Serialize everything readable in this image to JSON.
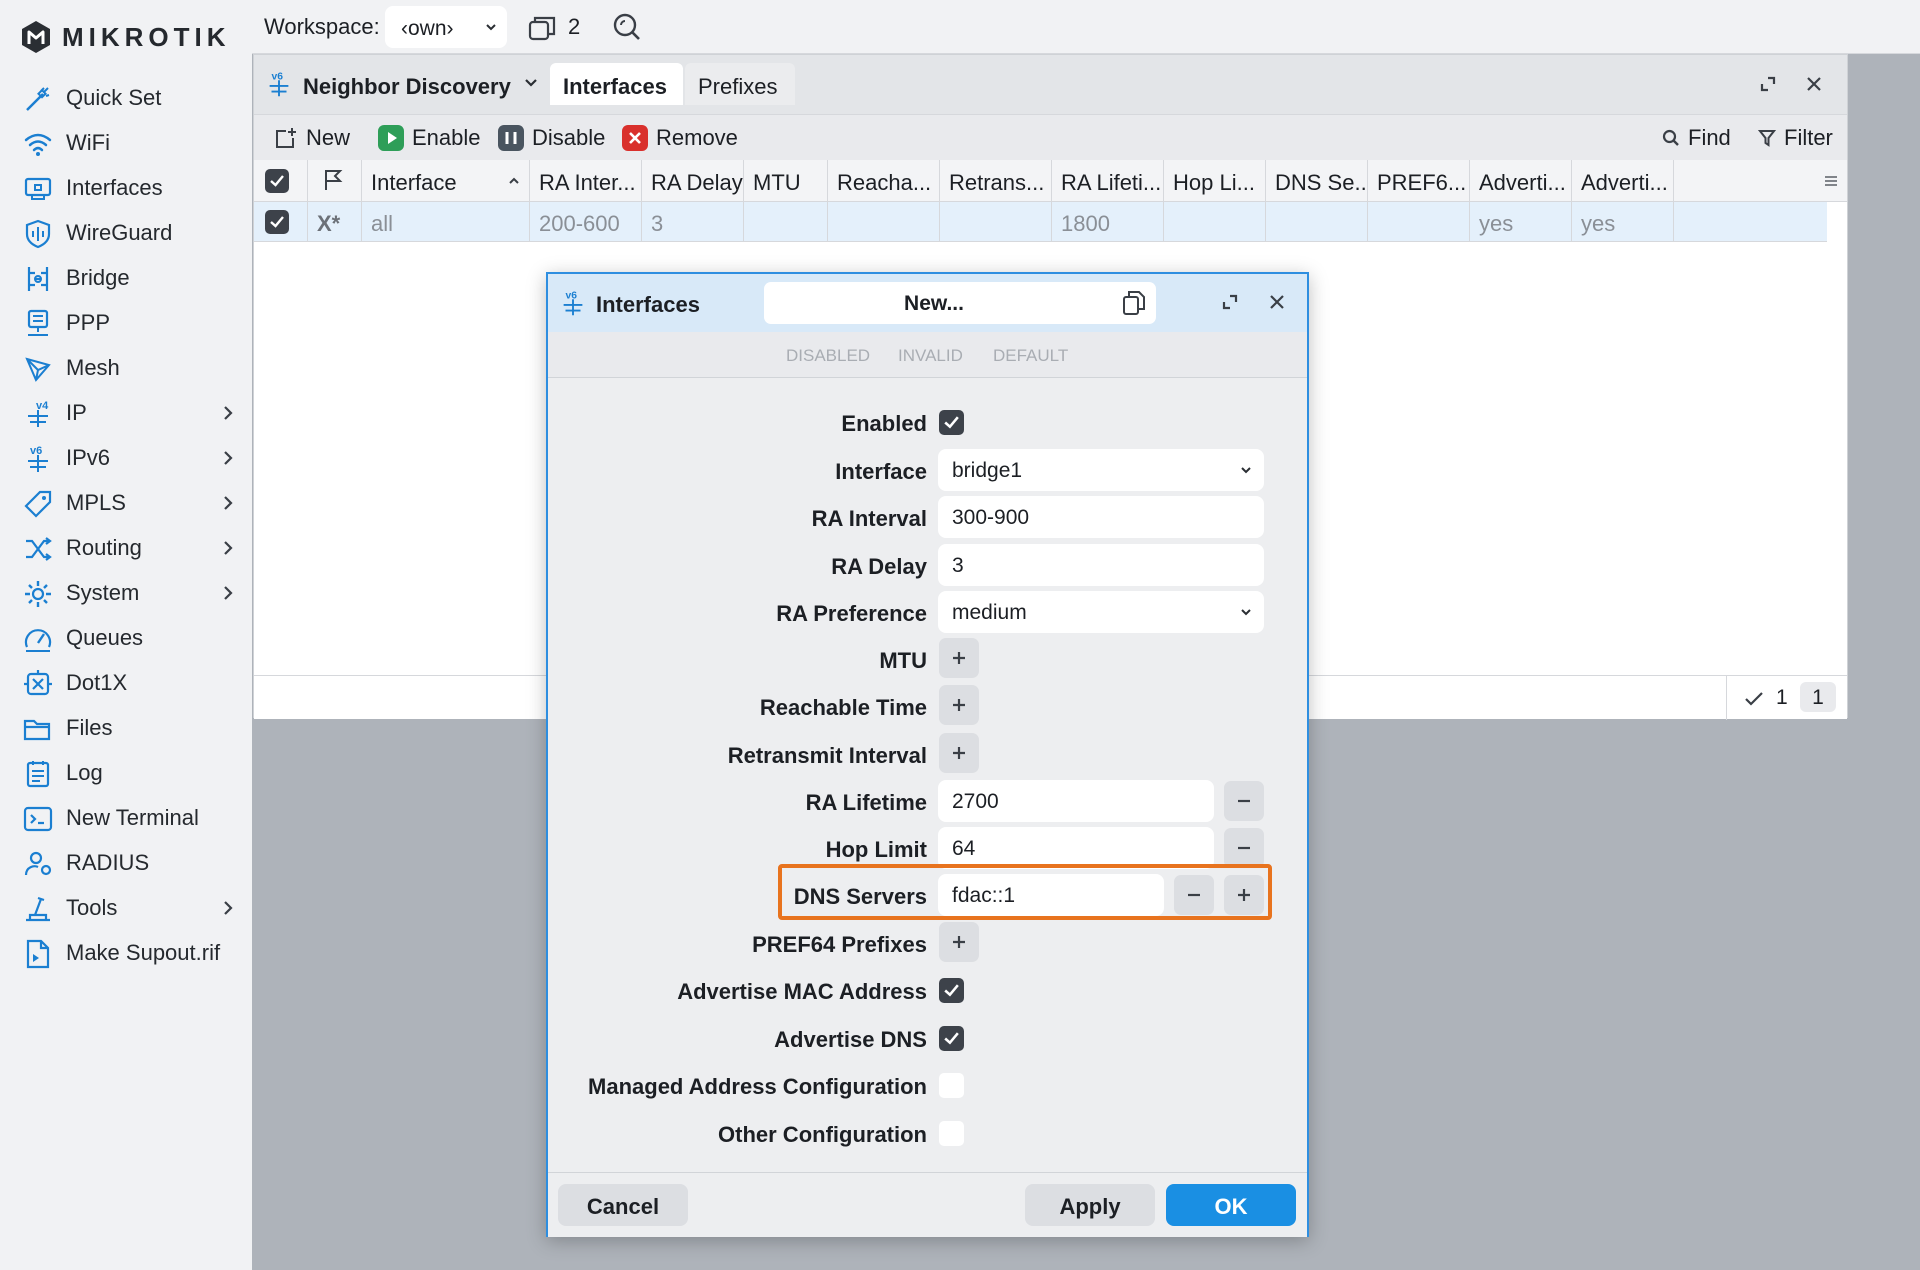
{
  "brand": {
    "name": "MIKROTIK"
  },
  "sidebar": {
    "items": [
      {
        "label": "Quick Set",
        "icon": "wand-icon"
      },
      {
        "label": "WiFi",
        "icon": "wifi-icon"
      },
      {
        "label": "Interfaces",
        "icon": "interfaces-icon"
      },
      {
        "label": "WireGuard",
        "icon": "shield-icon"
      },
      {
        "label": "Bridge",
        "icon": "bridge-icon"
      },
      {
        "label": "PPP",
        "icon": "ppp-icon"
      },
      {
        "label": "Mesh",
        "icon": "mesh-icon"
      },
      {
        "label": "IP",
        "icon": "ipv4-icon",
        "submenu": true
      },
      {
        "label": "IPv6",
        "icon": "ipv6-icon",
        "submenu": true
      },
      {
        "label": "MPLS",
        "icon": "tag-icon",
        "submenu": true
      },
      {
        "label": "Routing",
        "icon": "routing-icon",
        "submenu": true
      },
      {
        "label": "System",
        "icon": "gear-icon",
        "submenu": true
      },
      {
        "label": "Queues",
        "icon": "gauge-icon"
      },
      {
        "label": "Dot1X",
        "icon": "dot1x-icon"
      },
      {
        "label": "Files",
        "icon": "folder-icon"
      },
      {
        "label": "Log",
        "icon": "log-icon"
      },
      {
        "label": "New Terminal",
        "icon": "terminal-icon"
      },
      {
        "label": "RADIUS",
        "icon": "users-icon"
      },
      {
        "label": "Tools",
        "icon": "tools-icon",
        "submenu": true
      },
      {
        "label": "Make Supout.rif",
        "icon": "file-export-icon"
      }
    ]
  },
  "topbar": {
    "workspace_label": "Workspace:",
    "workspace_value": "‹own›",
    "window_count": "2"
  },
  "main_window": {
    "title": "Neighbor Discovery",
    "tabs": [
      {
        "label": "Interfaces",
        "active": true
      },
      {
        "label": "Prefixes",
        "active": false
      }
    ],
    "toolbar": {
      "new": "New",
      "enable": "Enable",
      "disable": "Disable",
      "remove": "Remove",
      "find": "Find",
      "filter": "Filter"
    },
    "columns": [
      "Interface",
      "RA Inter...",
      "RA Delay",
      "MTU",
      "Reacha...",
      "Retrans...",
      "RA Lifeti...",
      "Hop Li...",
      "DNS Se...",
      "PREF6...",
      "Adverti...",
      "Adverti..."
    ],
    "rows": [
      {
        "flags": "X*",
        "cells": [
          "all",
          "200-600",
          "3",
          "",
          "",
          "",
          "1800",
          "",
          "",
          "",
          "yes",
          "yes"
        ]
      }
    ],
    "status": {
      "selected": "1",
      "total": "1"
    }
  },
  "dialog": {
    "title": "Interfaces",
    "name": "New...",
    "flags": [
      "DISABLED",
      "INVALID",
      "DEFAULT"
    ],
    "fields": {
      "enabled": {
        "label": "Enabled",
        "checked": true
      },
      "interface": {
        "label": "Interface",
        "value": "bridge1"
      },
      "ra_interval": {
        "label": "RA Interval",
        "value": "300-900"
      },
      "ra_delay": {
        "label": "RA Delay",
        "value": "3"
      },
      "ra_preference": {
        "label": "RA Preference",
        "value": "medium"
      },
      "mtu": {
        "label": "MTU"
      },
      "reachable_time": {
        "label": "Reachable Time"
      },
      "retransmit_interval": {
        "label": "Retransmit Interval"
      },
      "ra_lifetime": {
        "label": "RA Lifetime",
        "value": "2700"
      },
      "hop_limit": {
        "label": "Hop Limit",
        "value": "64"
      },
      "dns_servers": {
        "label": "DNS Servers",
        "value": "fdac::1"
      },
      "pref64_prefixes": {
        "label": "PREF64 Prefixes"
      },
      "advertise_mac": {
        "label": "Advertise MAC Address",
        "checked": true
      },
      "advertise_dns": {
        "label": "Advertise DNS",
        "checked": true
      },
      "managed_address": {
        "label": "Managed Address Configuration",
        "checked": false
      },
      "other_config": {
        "label": "Other Configuration",
        "checked": false
      }
    },
    "buttons": {
      "cancel": "Cancel",
      "apply": "Apply",
      "ok": "OK"
    }
  },
  "colors": {
    "accent": "#1a8fe3",
    "highlight": "#e8731e",
    "enable_green": "#2e9e58",
    "remove_red": "#d9302c",
    "disable_gray": "#4a5560"
  }
}
